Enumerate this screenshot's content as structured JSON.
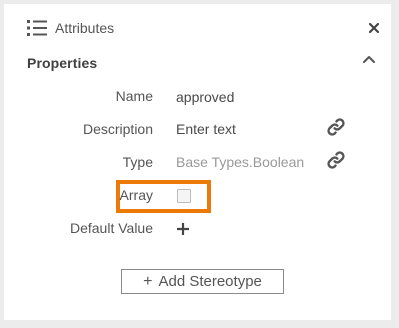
{
  "header": {
    "title": "Attributes",
    "icon": "list-icon",
    "close_icon": "close-icon"
  },
  "section": {
    "title": "Properties",
    "toggle_icon": "chevron-up-icon"
  },
  "fields": {
    "name": {
      "label": "Name",
      "value": "approved"
    },
    "description": {
      "label": "Description",
      "placeholder": "Enter text",
      "icon": "link-icon"
    },
    "type": {
      "label": "Type",
      "value": "Base Types.Boolean",
      "icon": "link-icon"
    },
    "array": {
      "label": "Array",
      "checked": false
    },
    "default_value": {
      "label": "Default Value",
      "icon": "plus-icon"
    }
  },
  "add_stereotype": {
    "icon": "+",
    "label": "Add Stereotype"
  },
  "colors": {
    "highlight": "#ec7a09",
    "text": "#4a4a4a",
    "muted": "#999999"
  }
}
